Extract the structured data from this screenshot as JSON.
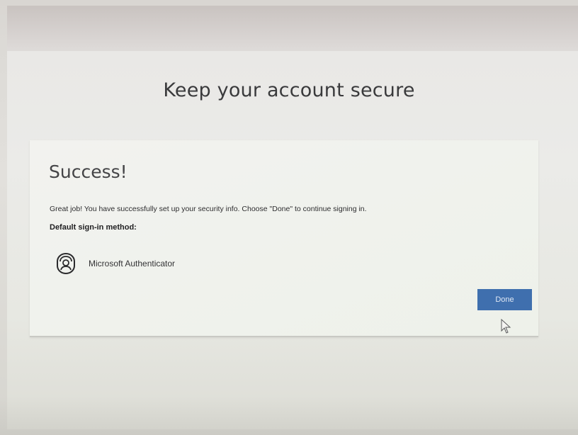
{
  "header": {
    "top_strip_text": ""
  },
  "page": {
    "title": "Keep your account secure"
  },
  "card": {
    "heading": "Success!",
    "message": "Great job! You have successfully set up your security info. Choose \"Done\" to continue signing in.",
    "default_method_label": "Default sign-in method:",
    "default_method": {
      "icon": "authenticator-app-icon",
      "name": "Microsoft Authenticator"
    },
    "done_button_label": "Done"
  },
  "colors": {
    "primary_button": "#3f6fae",
    "page_background": "#e9e9e5",
    "card_background": "#f0f2ed"
  }
}
